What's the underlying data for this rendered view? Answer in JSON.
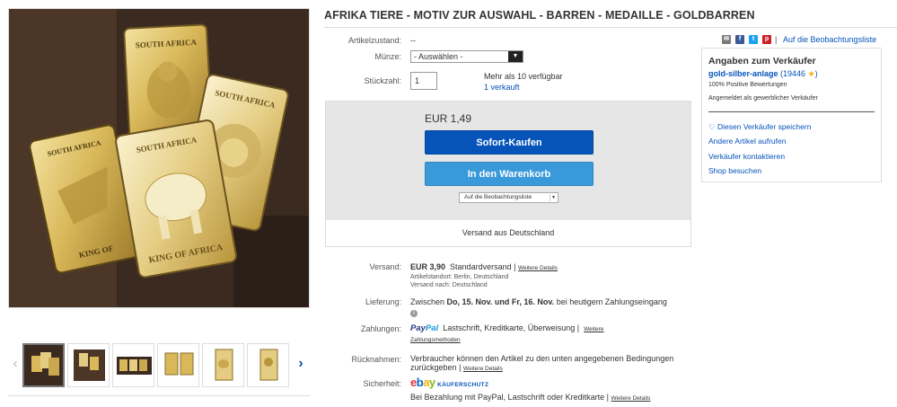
{
  "listing": {
    "title": "AFRIKA TIERE - MOTIV ZUR AUSWAHL - BARREN - MEDAILLE - GOLDBARREN",
    "condition_label": "Artikelzustand:",
    "condition_value": "--",
    "coin_label": "Münze:",
    "coin_select": "- Auswählen -",
    "qty_label": "Stückzahl:",
    "qty_value": "1",
    "availability": "Mehr als 10 verfügbar",
    "sold": "1 verkauft"
  },
  "image_text": {
    "south_africa": "SOUTH AFRICA",
    "king_of_africa": "KING OF AFRICA",
    "king_of": "KING OF"
  },
  "buybox": {
    "price": "EUR 1,49",
    "buy_now": "Sofort-Kaufen",
    "add_to_cart": "In den Warenkorb",
    "watch_dropdown": "Auf die Beobachtungsliste",
    "ships_from": "Versand aus Deutschland"
  },
  "details": {
    "shipping_label": "Versand:",
    "shipping_price": "EUR 3,90",
    "shipping_type": "Standardversand",
    "sep": "|",
    "more_details": "Weitere Details",
    "item_location": "Artikelstandort: Berlin, Deutschland",
    "ships_to": "Versand nach: Deutschland",
    "delivery_label": "Lieferung:",
    "delivery_prefix": "Zwischen",
    "delivery_dates": "Do, 15. Nov. und Fr, 16. Nov.",
    "delivery_suffix": "bei heutigem Zahlungseingang",
    "payments_label": "Zahlungen:",
    "paypal_part1": "Pay",
    "paypal_part2": "Pal",
    "payment_methods": "Lastschrift,  Kreditkarte,  Überweisung",
    "more_payments_1": "Weitere",
    "more_payments_2": "Zahlungsmethoden",
    "returns_label": "Rücknahmen:",
    "returns_line1": "Verbraucher können den Artikel zu den unten angegebenen Bedingungen",
    "returns_line2": "zurückgeben",
    "security_label": "Sicherheit:",
    "ebay_e": "e",
    "ebay_b": "b",
    "ebay_a": "a",
    "ebay_y": "y",
    "buyer_protection": "KÄUFERSCHUTZ",
    "protection_text": "Bei Bezahlung mit PayPal, Lastschrift oder Kreditkarte"
  },
  "share": {
    "watchlist_link": "Auf die Beobachtungsliste",
    "icons": [
      "mail-icon",
      "facebook-icon",
      "twitter-icon",
      "pinterest-icon"
    ],
    "colors": {
      "mail": "#7a7a7a",
      "facebook": "#3b5998",
      "twitter": "#1da1f2",
      "pinterest": "#cb2027"
    }
  },
  "seller": {
    "heading": "Angaben zum Verkäufer",
    "name": "gold-silber-anlage",
    "feedback_count": "19446",
    "positive": "100% Positive Bewertungen",
    "business": "Angemeldet als gewerblicher Verkäufer",
    "save_seller": "Diesen Verkäufer speichern",
    "other_items": "Andere Artikel aufrufen",
    "contact": "Verkäufer kontaktieren",
    "visit_shop": "Shop besuchen"
  },
  "colors": {
    "link_blue": "#0654ba",
    "buy_button": "#0654ba",
    "cart_button": "#3a9ad9",
    "star": "#f5af02"
  }
}
